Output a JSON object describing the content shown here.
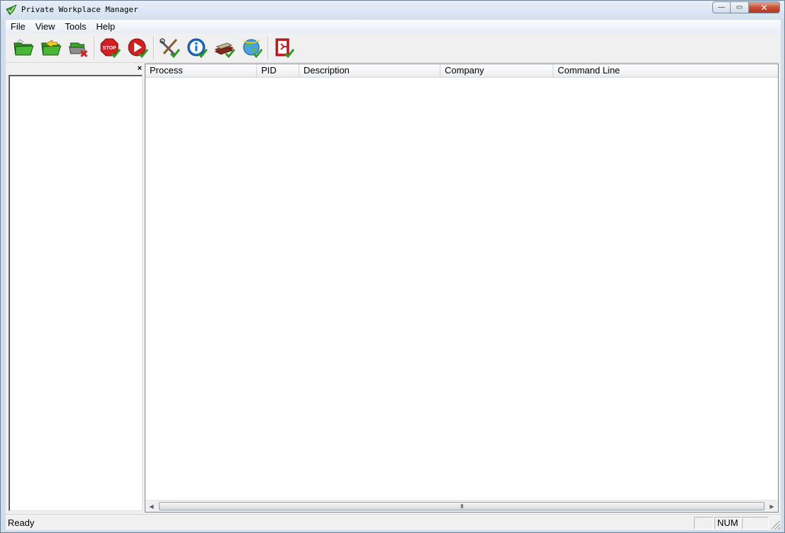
{
  "window": {
    "title": "Private Workplace Manager",
    "controls": {
      "minimize": "—",
      "maximize": "▭",
      "close": "✕"
    }
  },
  "menu": [
    "File",
    "View",
    "Tools",
    "Help"
  ],
  "toolbar": {
    "buttons": [
      {
        "icon": "folder-open-icon"
      },
      {
        "icon": "folder-arrow-icon"
      },
      {
        "icon": "drive-delete-icon"
      },
      {
        "icon": "stop-icon"
      },
      {
        "icon": "play-icon"
      },
      {
        "icon": "tools-icon"
      },
      {
        "icon": "info-icon"
      },
      {
        "icon": "books-icon"
      },
      {
        "icon": "globe-icon"
      },
      {
        "icon": "exit-icon"
      }
    ]
  },
  "left_pane": {
    "close_glyph": "×"
  },
  "listview": {
    "columns": [
      "Process",
      "PID",
      "Description",
      "Company",
      "Command Line"
    ],
    "rows": []
  },
  "statusbar": {
    "text": "Ready",
    "num": "NUM"
  },
  "scrollbar": {
    "left_arrow": "◀",
    "right_arrow": "▶",
    "grip": "III"
  },
  "colors": {
    "accent_green": "#3a9a2a",
    "stop_red": "#d21f1f",
    "frame": "#6b7f99"
  }
}
